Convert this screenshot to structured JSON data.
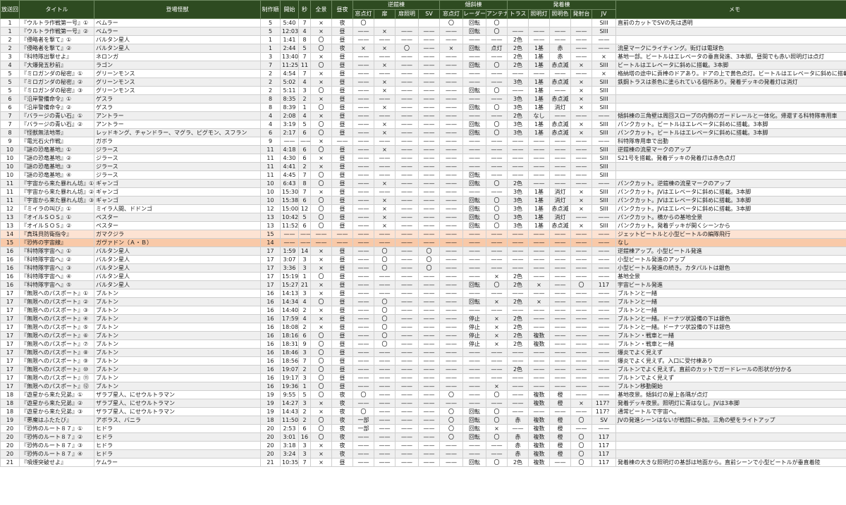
{
  "headers": {
    "row1": [
      "放送回",
      "タイトル",
      "登場怪獣",
      "制作順",
      "開始",
      "秒",
      "全景",
      "昼夜",
      "逆鎧棟",
      "傾斜棟",
      "発着棟",
      "メモ"
    ],
    "row2": [
      "窓点灯",
      "扉",
      "扉照明",
      "SV",
      "窓点灯",
      "レーダー",
      "アンテナ",
      "トラス",
      "照明灯",
      "照明色",
      "発射台",
      "JV"
    ]
  },
  "rows": [
    [
      "1",
      "『ウルトラ作戦第一号』①",
      "ベムラー",
      "5",
      "5:40",
      "7",
      "×",
      "夜",
      "〇",
      "",
      "",
      "",
      "〇",
      "回転",
      "〇",
      "",
      "",
      "",
      "",
      "SIII",
      "直前のカットでSVの先は透明"
    ],
    [
      "1",
      "『ウルトラ作戦第一号』②",
      "ベムラー",
      "5",
      "12:03",
      "4",
      "×",
      "昼",
      "——",
      "×",
      "——",
      "——",
      "——",
      "回転",
      "〇",
      "——",
      "——",
      "——",
      "——",
      "SIII",
      ""
    ],
    [
      "2",
      "『侵略者を撃て』①",
      "バルタン星人",
      "1",
      "1:41",
      "8",
      "〇",
      "昼",
      "——",
      "——",
      "——",
      "——",
      "——",
      "——",
      "——",
      "2色",
      "——",
      "——",
      "——",
      "——",
      ""
    ],
    [
      "2",
      "『侵略者を撃て』②",
      "バルタン星人",
      "1",
      "2:44",
      "5",
      "〇",
      "夜",
      "×",
      "×",
      "〇",
      "——",
      "×",
      "回転",
      "点灯",
      "2色",
      "1基",
      "赤",
      "——",
      "——",
      "流星マークにライティング。街灯は電球色"
    ],
    [
      "3",
      "『科特隊出撃せよ』",
      "ネロンガ",
      "3",
      "13:40",
      "7",
      "×",
      "昼",
      "——",
      "——",
      "——",
      "——",
      "——",
      "——",
      "——",
      "2色",
      "1基",
      "赤",
      "——",
      "×",
      "基地一部。ビートルはエレベータの垂直発進、3本脚。昼間でも赤い照明灯は点灯"
    ],
    [
      "4",
      "『大爆発五秒前』",
      "ラゴン",
      "7",
      "11:25",
      "11",
      "〇",
      "昼",
      "——",
      "×",
      "——",
      "——",
      "——",
      "回転",
      "〇",
      "2色",
      "1基",
      "赤点滅",
      "×",
      "SIII",
      "ビートルはエレベータに斜めに搭載。3本脚"
    ],
    [
      "5",
      "『ミロガンダの秘密』①",
      "グリーンモンス",
      "2",
      "4:54",
      "7",
      "×",
      "昼",
      "——",
      "——",
      "——",
      "——",
      "——",
      "——",
      "——",
      "——",
      "——",
      "——",
      "——",
      "×",
      "格納塔の途中に貢棒のドアあり。ドアの上で黄色点灯。ビートルはエレベータに斜めに搭載"
    ],
    [
      "5",
      "『ミロガンダの秘密』②",
      "グリーンモンス",
      "2",
      "5:02",
      "4",
      "×",
      "昼",
      "——",
      "×",
      "——",
      "——",
      "——",
      "——",
      "——",
      "3色",
      "1基",
      "赤点滅",
      "×",
      "SIII",
      "鉄鋼トラスは茶色に塗られている個所あり。発着デッキの発着灯は消灯"
    ],
    [
      "5",
      "『ミロガンダの秘密』③",
      "グリーンモンス",
      "2",
      "5:11",
      "3",
      "〇",
      "昼",
      "——",
      "×",
      "——",
      "——",
      "——",
      "回転",
      "〇",
      "——",
      "1基",
      "——",
      "×",
      "SIII",
      ""
    ],
    [
      "6",
      "『沿岸警備命令』①",
      "ゲスラ",
      "8",
      "8:35",
      "2",
      "×",
      "昼",
      "——",
      "——",
      "——",
      "——",
      "——",
      "——",
      "——",
      "3色",
      "1基",
      "赤点滅",
      "×",
      "SIII",
      ""
    ],
    [
      "6",
      "『沿岸警備命令』②",
      "ゲスラ",
      "8",
      "8:39",
      "1",
      "〇",
      "昼",
      "——",
      "×",
      "——",
      "——",
      "——",
      "回転",
      "〇",
      "3色",
      "1基",
      "消灯",
      "×",
      "SIII",
      ""
    ],
    [
      "7",
      "『バラージの青い石』①",
      "アントラー",
      "4",
      "2:08",
      "4",
      "×",
      "昼",
      "——",
      "——",
      "——",
      "——",
      "——",
      "——",
      "——",
      "2色",
      "なし",
      "——",
      "——",
      "——",
      "傾斜棟の三角壁は周回スロープの内側のガードレールと一体化。帰還する科特隊専用車"
    ],
    [
      "7",
      "『バラージの青い石』②",
      "アントラー",
      "4",
      "3:19",
      "5",
      "〇",
      "昼",
      "——",
      "×",
      "——",
      "——",
      "——",
      "回転",
      "〇",
      "3色",
      "1基",
      "赤点滅",
      "×",
      "SIII",
      "パンクカット。ビートルはエレベータに斜めに搭載。3本脚"
    ],
    [
      "8",
      "『怪獣無法地帯』",
      "レッドキング、チャンドラー、マグラ、ピグモン、スフラン",
      "6",
      "2:17",
      "6",
      "〇",
      "昼",
      "——",
      "×",
      "——",
      "——",
      "——",
      "回転",
      "〇",
      "3色",
      "1基",
      "赤点滅",
      "×",
      "SIII",
      "パンクカット。ビートルはエレベータに斜めに搭載。3本脚"
    ],
    [
      "9",
      "『電光石火作戦』",
      "ガボラ",
      "9",
      "——",
      "——",
      "×",
      "——",
      "——",
      "——",
      "——",
      "——",
      "——",
      "——",
      "——",
      "——",
      "——",
      "——",
      "——",
      "——",
      "科特隊専用車で出動"
    ],
    [
      "10",
      "『謎の恐竜基地』①",
      "ジラース",
      "11",
      "4:18",
      "6",
      "〇",
      "昼",
      "——",
      "×",
      "——",
      "——",
      "——",
      "——",
      "——",
      "——",
      "——",
      "——",
      "——",
      "SIII",
      "逆鎧棟の流星マークのアップ"
    ],
    [
      "10",
      "『謎の恐竜基地』②",
      "ジラース",
      "11",
      "4:30",
      "6",
      "×",
      "昼",
      "——",
      "——",
      "——",
      "——",
      "——",
      "——",
      "——",
      "——",
      "——",
      "——",
      "——",
      "SIII",
      "S21号を搭載。発着デッキの発着灯は赤色点灯"
    ],
    [
      "10",
      "『謎の恐竜基地』③",
      "ジラース",
      "11",
      "4:41",
      "2",
      "×",
      "昼",
      "——",
      "——",
      "——",
      "——",
      "——",
      "——",
      "——",
      "——",
      "——",
      "——",
      "——",
      "SIII",
      ""
    ],
    [
      "10",
      "『謎の恐竜基地』④",
      "ジラース",
      "11",
      "4:45",
      "7",
      "〇",
      "昼",
      "——",
      "——",
      "——",
      "——",
      "——",
      "回転",
      "——",
      "——",
      "——",
      "——",
      "——",
      "SIII",
      ""
    ],
    [
      "11",
      "『宇宙から来た暴れん坊』①",
      "ギャンゴ",
      "10",
      "6:43",
      "8",
      "〇",
      "昼",
      "——",
      "×",
      "——",
      "——",
      "——",
      "回転",
      "〇",
      "2色",
      "——",
      "——",
      "——",
      "——",
      "パンクカット。逆鎧棟の流星マークのアップ"
    ],
    [
      "11",
      "『宇宙から来た暴れん坊』②",
      "ギャンゴ",
      "10",
      "15:30",
      "7",
      "×",
      "昼",
      "——",
      "——",
      "——",
      "——",
      "——",
      "——",
      "——",
      "3色",
      "1基",
      "消灯",
      "×",
      "SIII",
      "パンクカット。JVはエレベータに斜めに搭載。3本脚"
    ],
    [
      "11",
      "『宇宙から来た暴れん坊』③",
      "ギャンゴ",
      "10",
      "15:38",
      "6",
      "〇",
      "昼",
      "——",
      "×",
      "——",
      "——",
      "——",
      "回転",
      "〇",
      "3色",
      "1基",
      "消灯",
      "×",
      "SIII",
      "パンクカット。JVはエレベータに斜めに搭載。3本脚"
    ],
    [
      "12",
      "『ミイラの叫び』①",
      "ミイラ人間、ドドンゴ",
      "12",
      "15:00",
      "12",
      "〇",
      "昼",
      "——",
      "×",
      "——",
      "——",
      "——",
      "回転",
      "〇",
      "3色",
      "1基",
      "赤点滅",
      "×",
      "SIII",
      "パンクカット。JVはエレベータに斜めに搭載。3本脚"
    ],
    [
      "13",
      "『オイルＳＯＳ』①",
      "ペスター",
      "13",
      "10:42",
      "5",
      "〇",
      "昼",
      "——",
      "×",
      "——",
      "——",
      "——",
      "回転",
      "〇",
      "3色",
      "1基",
      "消灯",
      "——",
      "——",
      "パンクカット。横からの基地全景"
    ],
    [
      "13",
      "『オイルＳＯＳ』②",
      "ペスター",
      "13",
      "11:52",
      "6",
      "〇",
      "昼",
      "——",
      "×",
      "——",
      "——",
      "——",
      "回転",
      "〇",
      "3色",
      "1基",
      "赤点滅",
      "×",
      "SIII",
      "パンクカット。発着デッキが開くシーンから"
    ],
    [
      "14",
      "『真珠貝防衛指令』",
      "ガマクジラ",
      "15",
      "——",
      "——",
      "——",
      "——",
      "——",
      "——",
      "——",
      "——",
      "——",
      "——",
      "——",
      "——",
      "——",
      "——",
      "——",
      "——",
      "ジェットビートルと小型ビートルの編隊飛行"
    ],
    [
      "15",
      "『恐怖の宇宙線』",
      "ガヴァドン（Ａ・Ｂ）",
      "14",
      "——",
      "——",
      "——",
      "——",
      "——",
      "——",
      "——",
      "——",
      "——",
      "——",
      "——",
      "——",
      "——",
      "——",
      "——",
      "——",
      "なし"
    ],
    [
      "16",
      "『科特隊宇宙へ』①",
      "バルタン星人",
      "17",
      "1:59",
      "14",
      "×",
      "昼",
      "——",
      "〇",
      "——",
      "〇",
      "——",
      "——",
      "——",
      "——",
      "——",
      "——",
      "——",
      "——",
      "逆鎧棟アップ。小型ビートル発進"
    ],
    [
      "16",
      "『科特隊宇宙へ』②",
      "バルタン星人",
      "17",
      "3:07",
      "3",
      "×",
      "昼",
      "——",
      "〇",
      "——",
      "〇",
      "——",
      "——",
      "——",
      "——",
      "——",
      "——",
      "——",
      "——",
      "小型ビートル発進のアップ"
    ],
    [
      "16",
      "『科特隊宇宙へ』③",
      "バルタン星人",
      "17",
      "3:36",
      "3",
      "×",
      "昼",
      "——",
      "〇",
      "——",
      "〇",
      "——",
      "——",
      "——",
      "——",
      "——",
      "——",
      "——",
      "——",
      "小型ビートル発進の続き。カタパルトは銀色"
    ],
    [
      "16",
      "『科特隊宇宙へ』④",
      "バルタン星人",
      "17",
      "15:19",
      "1",
      "〇",
      "昼",
      "——",
      "——",
      "——",
      "——",
      "——",
      "——",
      "×",
      "2色",
      "——",
      "——",
      "——",
      "——",
      "基地全景"
    ],
    [
      "16",
      "『科特隊宇宙へ』⑤",
      "バルタン星人",
      "17",
      "15:27",
      "21",
      "×",
      "昼",
      "——",
      "——",
      "——",
      "——",
      "——",
      "回転",
      "〇",
      "2色",
      "×",
      "——",
      "〇",
      "117",
      "宇宙ビートル発進"
    ],
    [
      "17",
      "『無限へのパスポート』①",
      "ブルトン",
      "16",
      "14:13",
      "3",
      "×",
      "昼",
      "——",
      "——",
      "——",
      "——",
      "——",
      "——",
      "——",
      "——",
      "——",
      "——",
      "——",
      "——",
      "ブルトンと一緒"
    ],
    [
      "17",
      "『無限へのパスポート』②",
      "ブルトン",
      "16",
      "14:34",
      "4",
      "〇",
      "昼",
      "——",
      "〇",
      "——",
      "——",
      "——",
      "回転",
      "×",
      "2色",
      "×",
      "——",
      "——",
      "——",
      "ブルトンと一緒"
    ],
    [
      "17",
      "『無限へのパスポート』③",
      "ブルトン",
      "16",
      "14:40",
      "2",
      "×",
      "昼",
      "——",
      "〇",
      "——",
      "——",
      "——",
      "——",
      "——",
      "——",
      "——",
      "——",
      "——",
      "——",
      "ブルトンと一緒"
    ],
    [
      "17",
      "『無限へのパスポート』④",
      "ブルトン",
      "16",
      "17:59",
      "4",
      "×",
      "昼",
      "——",
      "〇",
      "——",
      "——",
      "——",
      "停止",
      "×",
      "2色",
      "——",
      "——",
      "——",
      "——",
      "ブルトンと一緒。ドーナツ状設備の下は銀色"
    ],
    [
      "17",
      "『無限へのパスポート』⑤",
      "ブルトン",
      "16",
      "18:08",
      "2",
      "×",
      "昼",
      "——",
      "〇",
      "——",
      "——",
      "——",
      "停止",
      "×",
      "2色",
      "——",
      "——",
      "——",
      "——",
      "ブルトンと一緒。ドーナツ状設備の下は銀色"
    ],
    [
      "17",
      "『無限へのパスポート』⑥",
      "ブルトン",
      "16",
      "18:16",
      "6",
      "〇",
      "昼",
      "——",
      "〇",
      "——",
      "——",
      "——",
      "停止",
      "×",
      "2色",
      "複数",
      "——",
      "——",
      "——",
      "ブルトン・戦車と一緒"
    ],
    [
      "17",
      "『無限へのパスポート』⑦",
      "ブルトン",
      "16",
      "18:31",
      "9",
      "〇",
      "昼",
      "——",
      "〇",
      "——",
      "——",
      "——",
      "停止",
      "×",
      "2色",
      "複数",
      "——",
      "——",
      "——",
      "ブルトン・戦車と一緒"
    ],
    [
      "17",
      "『無限へのパスポート』⑧",
      "ブルトン",
      "16",
      "18:46",
      "3",
      "〇",
      "昼",
      "——",
      "——",
      "——",
      "——",
      "——",
      "——",
      "——",
      "——",
      "——",
      "——",
      "——",
      "——",
      "爆炎でよく見えず"
    ],
    [
      "17",
      "『無限へのパスポート』⑨",
      "ブルトン",
      "16",
      "18:56",
      "7",
      "〇",
      "昼",
      "——",
      "——",
      "——",
      "——",
      "——",
      "——",
      "——",
      "——",
      "——",
      "——",
      "——",
      "——",
      "爆炎でよく見えず。入口に受付棟あり"
    ],
    [
      "17",
      "『無限へのパスポート』⑩",
      "ブルトン",
      "16",
      "19:07",
      "2",
      "〇",
      "昼",
      "——",
      "——",
      "——",
      "——",
      "——",
      "——",
      "——",
      "2色",
      "——",
      "——",
      "——",
      "——",
      "ブルトンでよく見えず。直前のカットでガードレールの形状が分かる"
    ],
    [
      "17",
      "『無限へのパスポート』⑪",
      "ブルトン",
      "16",
      "19:17",
      "3",
      "〇",
      "昼",
      "——",
      "——",
      "——",
      "——",
      "——",
      "——",
      "——",
      "——",
      "——",
      "——",
      "——",
      "——",
      "ブルトンでよく見えず"
    ],
    [
      "17",
      "『無限へのパスポート』⑫",
      "ブルトン",
      "16",
      "19:36",
      "1",
      "〇",
      "昼",
      "——",
      "——",
      "——",
      "——",
      "——",
      "——",
      "×",
      "——",
      "——",
      "——",
      "——",
      "——",
      "ブルトン移動開始"
    ],
    [
      "18",
      "『遊星から来た兄弟』①",
      "ザラブ星人、にせウルトラマン",
      "19",
      "9:55",
      "5",
      "〇",
      "夜",
      "〇",
      "——",
      "——",
      "——",
      "〇",
      "——",
      "〇",
      "——",
      "複数",
      "橙",
      "——",
      "——",
      "基地夜景。傾斜灯の屋上各隅が点灯"
    ],
    [
      "18",
      "『遊星から来た兄弟』②",
      "ザラブ星人、にせウルトラマン",
      "19",
      "14:27",
      "3",
      "×",
      "夜",
      "——",
      "——",
      "——",
      "——",
      "——",
      "——",
      "——",
      "——",
      "複数",
      "橙",
      "×",
      "117？",
      "発着デッキ夜景。照明灯に青はなし。JVは3本脚"
    ],
    [
      "18",
      "『遊星から来た兄弟』③",
      "ザラブ星人、にせウルトラマン",
      "19",
      "14:43",
      "2",
      "×",
      "夜",
      "〇",
      "——",
      "——",
      "——",
      "〇",
      "回転",
      "〇",
      "——",
      "——",
      "——",
      "——",
      "117？",
      "通常ビートルで宇宙へ。"
    ],
    [
      "19",
      "『悪魔はふたたび』",
      "アボラス、バニラ",
      "18",
      "11:50",
      "2",
      "〇",
      "夜",
      "一部",
      "——",
      "——",
      "——",
      "〇",
      "回転",
      "〇",
      "赤",
      "複数",
      "橙",
      "〇",
      "SV",
      "JVの発進シーンはないが戦闘に参加。三角の壁をライトアップ"
    ],
    [
      "20",
      "『恐怖のルート８７』①",
      "ヒドラ",
      "20",
      "2:53",
      "6",
      "〇",
      "夜",
      "一部",
      "——",
      "——",
      "——",
      "〇",
      "回転",
      "×",
      "——",
      "複数",
      "橙",
      "——",
      "——",
      ""
    ],
    [
      "20",
      "『恐怖のルート８７』②",
      "ヒドラ",
      "20",
      "3:01",
      "16",
      "〇",
      "夜",
      "——",
      "——",
      "——",
      "——",
      "〇",
      "回転",
      "〇",
      "赤",
      "複数",
      "橙",
      "〇",
      "117",
      ""
    ],
    [
      "20",
      "『恐怖のルート８７』③",
      "ヒドラ",
      "20",
      "3:18",
      "3",
      "×",
      "夜",
      "——",
      "——",
      "——",
      "——",
      "——",
      "——",
      "——",
      "赤",
      "複数",
      "橙",
      "〇",
      "117",
      ""
    ],
    [
      "20",
      "『恐怖のルート８７』④",
      "ヒドラ",
      "20",
      "3:24",
      "3",
      "×",
      "夜",
      "——",
      "——",
      "——",
      "——",
      "——",
      "——",
      "——",
      "赤",
      "複数",
      "橙",
      "〇",
      "117",
      ""
    ],
    [
      "21",
      "『噴煙突破せよ』",
      "ケムラー",
      "21",
      "10:35",
      "7",
      "×",
      "昼",
      "——",
      "——",
      "——",
      "——",
      "——",
      "回転",
      "〇",
      "2色",
      "複数",
      "——",
      "〇",
      "117",
      "発着棟の大きな照明灯の基部は地面から。直前シーンで小型ビートルが垂直着陸"
    ]
  ]
}
